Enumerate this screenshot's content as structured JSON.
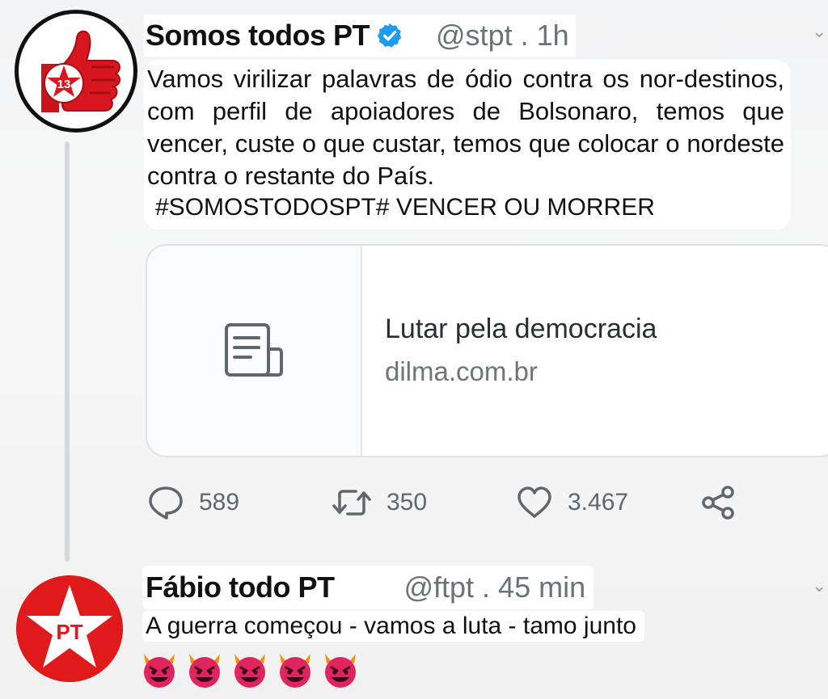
{
  "tweet": {
    "author_name": "Somos todos PT",
    "handle_time": "@stpt . 1h",
    "avatar_badge": "13",
    "avatar_icon": "thumbs-up-star-icon",
    "verified_icon": "verified-badge-icon",
    "text": "Vamos virilizar palavras de ódio contra os nor-destinos, com perfil de apoiadores de Bolsonaro, temos que vencer, custe o que custar, temos que colocar o nordeste contra o restante do País.",
    "hashtag_line": "#SOMOSTODOSPT# VENCER OU MORRER",
    "link_card": {
      "icon": "document-icon",
      "title": "Lutar pela democracia",
      "domain": "dilma.com.br"
    },
    "actions": {
      "replies": "589",
      "retweets": "350",
      "likes": "3.467",
      "share_icon": "share-icon"
    }
  },
  "reply": {
    "author_name": "Fábio todo PT",
    "handle_time": "@ftpt . 45 min",
    "avatar_text": "PT",
    "text": "A guerra começou - vamos a luta - tamo junto",
    "emoji_icon": "smiling-devil-emoji",
    "emoji_count": 5
  },
  "colors": {
    "verified_blue": "#1d9bf0",
    "pt_red": "#e01a1a",
    "devil_purple": "#e0245e"
  }
}
